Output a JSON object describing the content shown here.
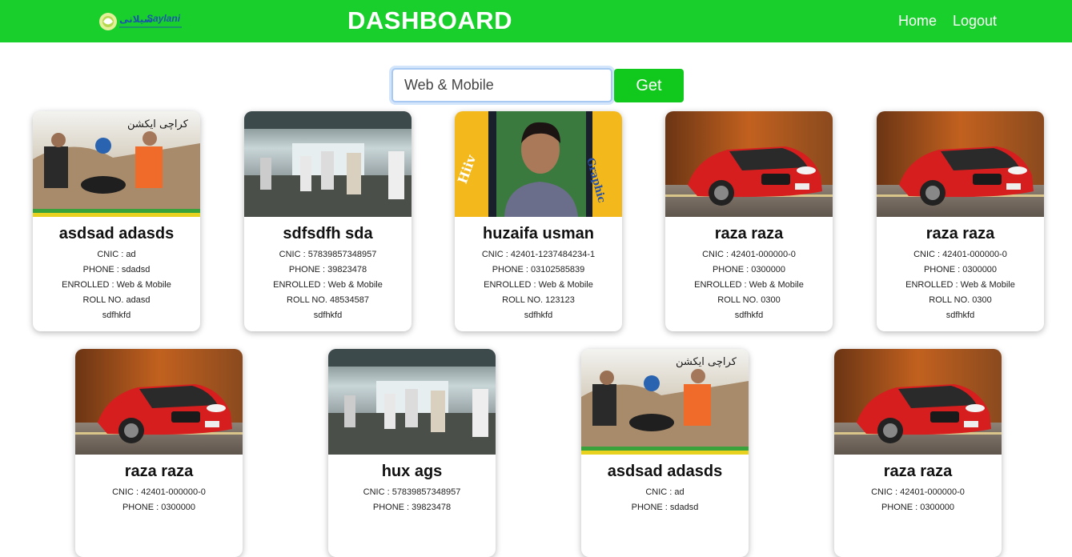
{
  "header": {
    "logo_text": "Saylani",
    "title": "DASHBOARD",
    "nav": {
      "home": "Home",
      "logout": "Logout"
    },
    "color": "#19cf2b"
  },
  "search": {
    "value": "Web & Mobile",
    "button": "Get"
  },
  "labels": {
    "cnic": "CNIC : ",
    "phone": "PHONE : ",
    "enrolled": "ENROLLED : ",
    "roll": "ROLL NO. "
  },
  "cards": [
    {
      "name": "asdsad adasds",
      "cnic": "CNIC : ad",
      "phone": "PHONE : sdadsd",
      "enrolled": "ENROLLED : Web & Mobile",
      "roll": "ROLL NO. adasd",
      "extra": "sdfhkfd",
      "image": "students-lifting-tyre-photo"
    },
    {
      "name": "sdfsdfh sda",
      "cnic": "CNIC : 57839857348957",
      "phone": "PHONE : 39823478",
      "enrolled": "ENROLLED : Web & Mobile",
      "roll": "ROLL NO. 48534587",
      "extra": "sdfhkfd",
      "image": "hall-people-photo"
    },
    {
      "name": "huzaifa usman",
      "cnic": "CNIC : 42401-1237484234-1",
      "phone": "PHONE : 03102585839",
      "enrolled": "ENROLLED : Web & Mobile",
      "roll": "ROLL NO. 123123",
      "extra": "sdfhkfd",
      "image": "portrait-photo"
    },
    {
      "name": "raza raza",
      "cnic": "CNIC : 42401-000000-0",
      "phone": "PHONE : 0300000",
      "enrolled": "ENROLLED : Web & Mobile",
      "roll": "ROLL NO. 0300",
      "extra": "sdfhkfd",
      "image": "red-car-photo"
    },
    {
      "name": "raza raza",
      "cnic": "CNIC : 42401-000000-0",
      "phone": "PHONE : 0300000",
      "enrolled": "ENROLLED : Web & Mobile",
      "roll": "ROLL NO. 0300",
      "extra": "sdfhkfd",
      "image": "red-car-photo"
    },
    {
      "name": "raza raza",
      "cnic": "CNIC : 42401-000000-0",
      "phone": "PHONE : 0300000",
      "enrolled": "",
      "roll": "",
      "extra": "",
      "image": "red-car-photo"
    },
    {
      "name": "hux ags",
      "cnic": "CNIC : 57839857348957",
      "phone": "PHONE : 39823478",
      "enrolled": "",
      "roll": "",
      "extra": "",
      "image": "hall-people-photo"
    },
    {
      "name": "asdsad adasds",
      "cnic": "CNIC : ad",
      "phone": "PHONE : sdadsd",
      "enrolled": "",
      "roll": "",
      "extra": "",
      "image": "students-lifting-tyre-photo"
    },
    {
      "name": "raza raza",
      "cnic": "CNIC : 42401-000000-0",
      "phone": "PHONE : 0300000",
      "enrolled": "",
      "roll": "",
      "extra": "",
      "image": "red-car-photo"
    }
  ]
}
